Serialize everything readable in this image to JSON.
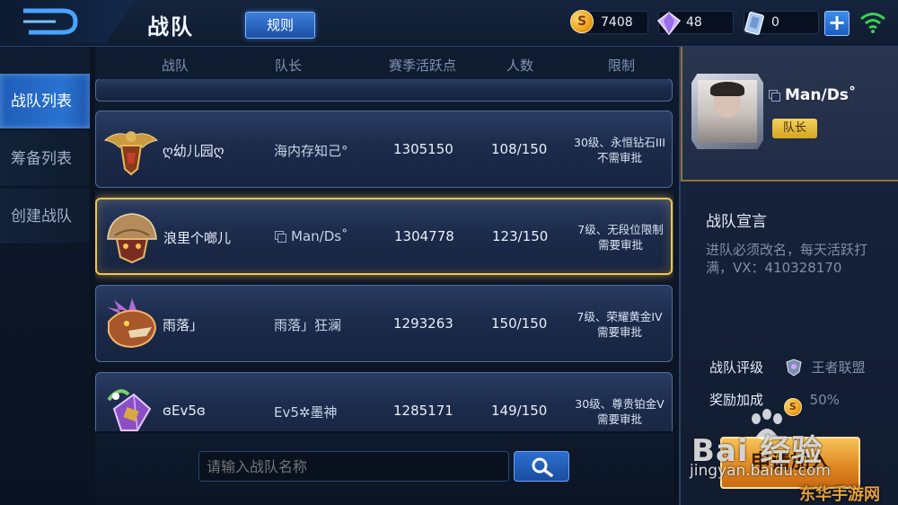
{
  "header": {
    "title": "战队",
    "rules_label": "规则",
    "resources": [
      {
        "name": "gold-coins",
        "icon": "coin-icon",
        "value": "7408"
      },
      {
        "name": "diamonds",
        "icon": "diamond-icon",
        "value": "48"
      },
      {
        "name": "vouchers",
        "icon": "voucher-icon",
        "value": "0"
      }
    ],
    "plus_label": "+"
  },
  "sidenav": {
    "items": [
      {
        "label": "战队列表",
        "active": true
      },
      {
        "label": "筹备列表",
        "active": false
      },
      {
        "label": "创建战队",
        "active": false
      }
    ]
  },
  "table": {
    "columns": [
      "战队",
      "队长",
      "赛季活跃点",
      "人数",
      "限制"
    ],
    "rows": [
      {
        "name": "ღ幼儿园ღ",
        "leader": "海内存知己°",
        "points": "1305150",
        "members": "108/150",
        "limit_line1": "30级、永恒钻石III",
        "limit_line2": "不需审批",
        "emblem": "eagle-emblem-icon",
        "selected": false
      },
      {
        "name": "浪里个啷儿",
        "leader": "Man/Ds˚",
        "points": "1304778",
        "members": "123/150",
        "limit_line1": "7级、无段位限制",
        "limit_line2": "需要审批",
        "emblem": "helmet-emblem-icon",
        "selected": true
      },
      {
        "name": "雨落」",
        "leader": "雨落」狂澜",
        "points": "1293263",
        "members": "150/150",
        "limit_line1": "7级、荣耀黄金IV",
        "limit_line2": "需要审批",
        "emblem": "dragon-emblem-icon",
        "selected": false
      },
      {
        "name": "ɞEv5ɞ",
        "leader": "Ev5✲墨神",
        "points": "1285171",
        "members": "149/150",
        "limit_line1": "30级、尊贵铂金V",
        "limit_line2": "需要审批",
        "emblem": "crystal-emblem-icon",
        "selected": false
      }
    ]
  },
  "search": {
    "placeholder": "请输入战队名称"
  },
  "detail": {
    "leader_name": "Man/Ds˚",
    "leader_badge": "队长",
    "declaration_title": "战队宣言",
    "declaration_text": "进队必须改名，每天活跃打满，VX：410328170",
    "rating_label": "战队评级",
    "rating_value": "王者联盟",
    "bonus_label": "奖励加成",
    "bonus_value": "50%",
    "join_label": "申请加入"
  },
  "watermark": {
    "baidu": "Bai 经验",
    "url": "jingyan.baidu.com",
    "site": "东华手游网"
  },
  "colors": {
    "accent_blue": "#2a72d0",
    "selected_gold": "#f2c64a",
    "join_orange": "#e08a24"
  }
}
